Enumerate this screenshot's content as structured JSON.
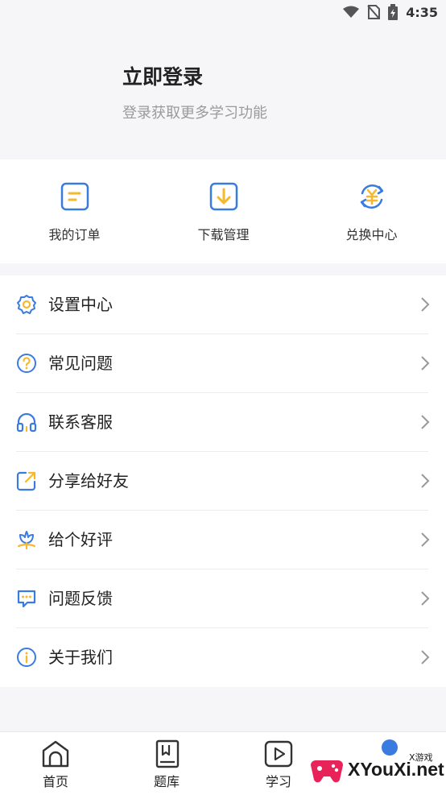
{
  "status_bar": {
    "time": "4:35",
    "icons": [
      "wifi-icon",
      "no-sim-icon",
      "battery-charging-icon"
    ]
  },
  "login": {
    "title": "立即登录",
    "subtitle": "登录获取更多学习功能"
  },
  "quick_actions": [
    {
      "label": "我的订单",
      "icon": "order-icon"
    },
    {
      "label": "下载管理",
      "icon": "download-icon"
    },
    {
      "label": "兑换中心",
      "icon": "exchange-icon"
    }
  ],
  "menu": [
    {
      "label": "设置中心",
      "icon": "gear-icon"
    },
    {
      "label": "常见问题",
      "icon": "question-icon"
    },
    {
      "label": "联系客服",
      "icon": "headset-icon"
    },
    {
      "label": "分享给好友",
      "icon": "share-icon"
    },
    {
      "label": "给个好评",
      "icon": "flower-icon"
    },
    {
      "label": "问题反馈",
      "icon": "feedback-icon"
    },
    {
      "label": "关于我们",
      "icon": "info-icon"
    }
  ],
  "tab_bar": [
    {
      "label": "首页",
      "icon": "home-icon"
    },
    {
      "label": "题库",
      "icon": "question-bank-icon"
    },
    {
      "label": "学习",
      "icon": "video-play-icon"
    }
  ],
  "watermark": {
    "text": "XYouXi.net",
    "small": "X游戏"
  },
  "colors": {
    "accent_blue": "#3a7be0",
    "accent_yellow": "#f5b82e",
    "background": "#f6f6f8"
  }
}
